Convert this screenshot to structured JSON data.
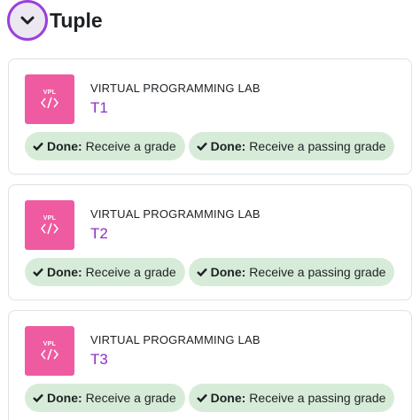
{
  "section": {
    "title": "Tuple",
    "toggle_icon": "chevron-down-icon"
  },
  "activities": [
    {
      "icon_label": "VPL",
      "type": "VIRTUAL PROGRAMMING LAB",
      "name": "T1",
      "completions": [
        {
          "status": "Done:",
          "text": "Receive a grade"
        },
        {
          "status": "Done:",
          "text": "Receive a passing grade"
        }
      ]
    },
    {
      "icon_label": "VPL",
      "type": "VIRTUAL PROGRAMMING LAB",
      "name": "T2",
      "completions": [
        {
          "status": "Done:",
          "text": "Receive a grade"
        },
        {
          "status": "Done:",
          "text": "Receive a passing grade"
        }
      ]
    },
    {
      "icon_label": "VPL",
      "type": "VIRTUAL PROGRAMMING LAB",
      "name": "T3",
      "completions": [
        {
          "status": "Done:",
          "text": "Receive a grade"
        },
        {
          "status": "Done:",
          "text": "Receive a passing grade"
        }
      ]
    }
  ],
  "colors": {
    "accent": "#8e2fc6",
    "vpl_icon_bg": "#ef5ba1",
    "done_badge_bg": "#d7ecd8",
    "check": "#1d2125"
  }
}
